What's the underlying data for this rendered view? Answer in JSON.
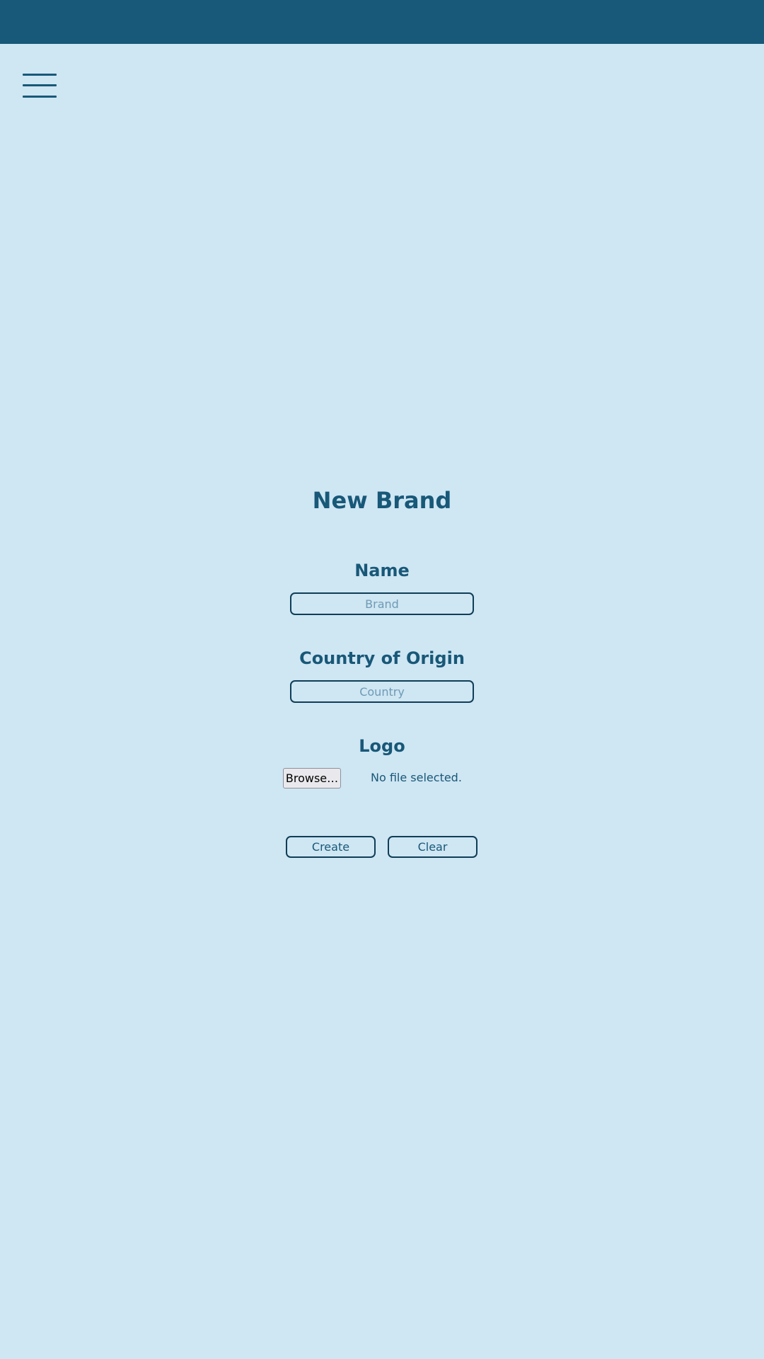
{
  "colors": {
    "background": "#cfe6f3",
    "topbar": "#185878",
    "accent": "#185878",
    "border": "#0f3e57"
  },
  "header": {
    "menu_icon": "hamburger-menu-icon"
  },
  "form": {
    "title": "New Brand",
    "name": {
      "label": "Name",
      "placeholder": "Brand",
      "value": ""
    },
    "country": {
      "label": "Country of Origin",
      "placeholder": "Country",
      "value": ""
    },
    "logo": {
      "label": "Logo",
      "browse_label": "Browse…",
      "file_status": "No file selected."
    },
    "actions": {
      "create_label": "Create",
      "clear_label": "Clear"
    }
  }
}
